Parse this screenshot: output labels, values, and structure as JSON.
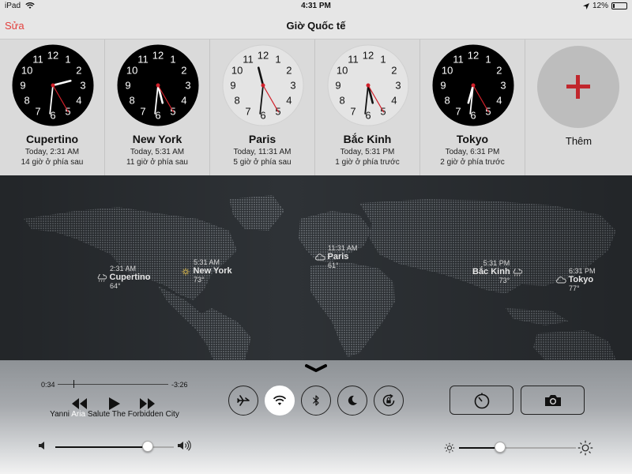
{
  "status_bar": {
    "device": "iPad",
    "time": "4:31 PM",
    "battery": "12%"
  },
  "nav": {
    "edit": "Sửa",
    "title": "Giờ Quốc tế"
  },
  "clocks": [
    {
      "city": "Cupertino",
      "today": "Today, 2:31 AM",
      "offset": "14 giờ ở phía sau",
      "face": "dark",
      "hour": 2,
      "minute": 31,
      "second": 25
    },
    {
      "city": "New York",
      "today": "Today, 5:31 AM",
      "offset": "11 giờ ở phía sau",
      "face": "dark",
      "hour": 5,
      "minute": 31,
      "second": 25
    },
    {
      "city": "Paris",
      "today": "Today, 11:31 AM",
      "offset": "5 giờ ở phía sau",
      "face": "light",
      "hour": 11,
      "minute": 31,
      "second": 25
    },
    {
      "city": "Bắc Kinh",
      "today": "Today, 5:31 PM",
      "offset": "1 giờ ở phía trước",
      "face": "light",
      "hour": 5,
      "minute": 31,
      "second": 25
    },
    {
      "city": "Tokyo",
      "today": "Today, 6:31 PM",
      "offset": "2 giờ ở phía trước",
      "face": "dark",
      "hour": 6,
      "minute": 31,
      "second": 25
    }
  ],
  "clock_numerals": [
    "12",
    "1",
    "2",
    "3",
    "4",
    "5",
    "6",
    "7",
    "8",
    "9",
    "10",
    "11"
  ],
  "add": {
    "label": "Thêm"
  },
  "map_markers": [
    {
      "time": "2:31 AM",
      "city": "Cupertino",
      "temp": "64°",
      "weather": "rain-cloud-icon"
    },
    {
      "time": "5:31 AM",
      "city": "New York",
      "temp": "73°",
      "weather": "sun-icon"
    },
    {
      "time": "11:31 AM",
      "city": "Paris",
      "temp": "61°",
      "weather": "cloud-icon"
    },
    {
      "time": "5:31 PM",
      "city": "Bắc Kinh",
      "temp": "73°",
      "weather": "rain-cloud-icon"
    },
    {
      "time": "6:31 PM",
      "city": "Tokyo",
      "temp": "77°",
      "weather": "cloud-icon"
    }
  ],
  "media": {
    "elapsed": "0:34",
    "remaining": "-3:26",
    "progress": 0.14,
    "artist": "Yanni",
    "album": "Aria",
    "title": "Salute The Forbidden City",
    "volume": 0.78
  },
  "brightness": 0.35,
  "toggles": [
    {
      "name": "airplane-mode-icon",
      "active": false
    },
    {
      "name": "wifi-icon",
      "active": true
    },
    {
      "name": "bluetooth-icon",
      "active": false
    },
    {
      "name": "do-not-disturb-icon",
      "active": false
    },
    {
      "name": "rotation-lock-icon",
      "active": false
    }
  ],
  "colors": {
    "accent": "#e3403d",
    "plus": "#c1272d",
    "second_hand": "#d0202a"
  }
}
